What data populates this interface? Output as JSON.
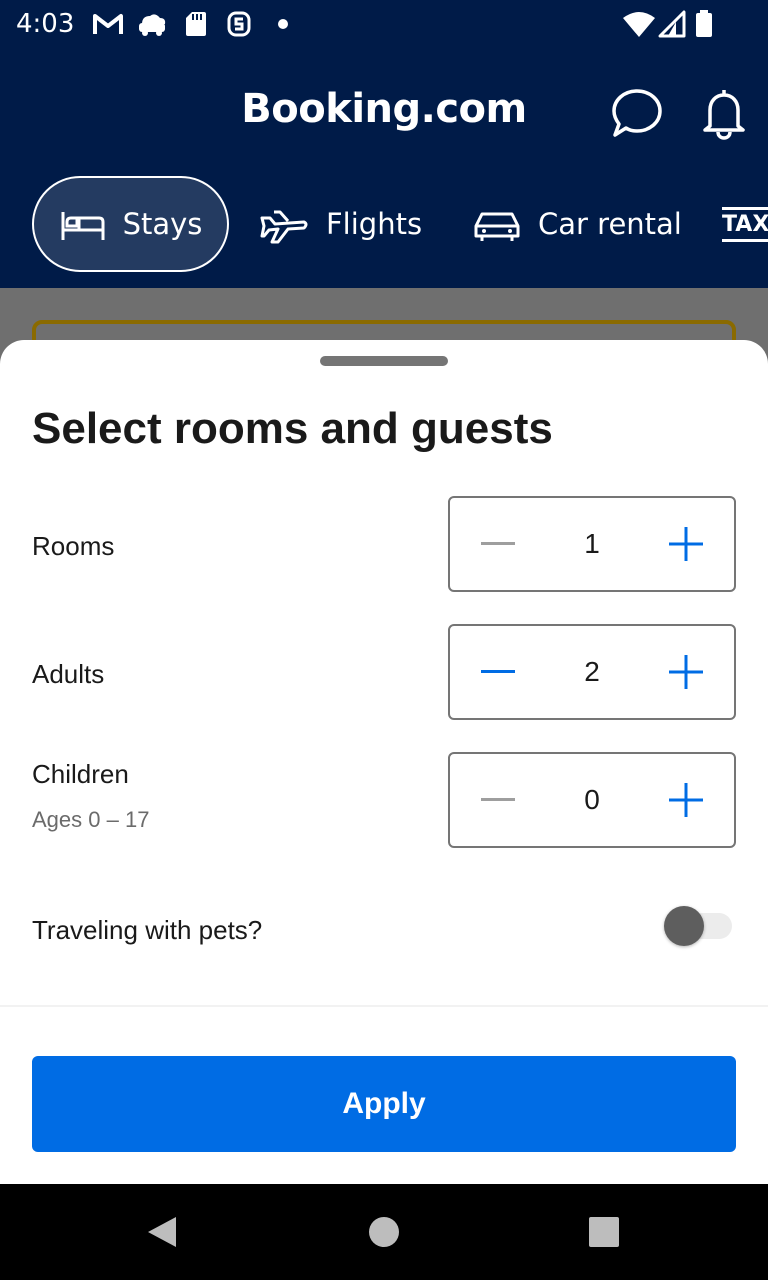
{
  "status_bar": {
    "time": "4:03",
    "left_icons": [
      "gmail-icon",
      "cloud-car-icon",
      "sd-card-icon",
      "s-icon",
      "dot-icon"
    ],
    "right_icons": [
      "wifi-icon",
      "signal-icon",
      "battery-icon"
    ]
  },
  "header": {
    "logo": "Booking.com",
    "actions": [
      "chat-icon",
      "bell-icon"
    ],
    "tabs": [
      {
        "label": "Stays",
        "icon": "bed-icon",
        "selected": true
      },
      {
        "label": "Flights",
        "icon": "plane-icon",
        "selected": false
      },
      {
        "label": "Car rental",
        "icon": "car-icon",
        "selected": false
      },
      {
        "label": "TAXI",
        "icon": "taxi-icon",
        "selected": false
      }
    ]
  },
  "sheet": {
    "title": "Select rooms and guests",
    "rooms": {
      "label": "Rooms",
      "value": "1",
      "minus_enabled": false
    },
    "adults": {
      "label": "Adults",
      "value": "2",
      "minus_enabled": true
    },
    "children": {
      "label": "Children",
      "sublabel": "Ages 0 – 17",
      "value": "0",
      "minus_enabled": false
    },
    "pets": {
      "label": "Traveling with pets?",
      "on": false
    },
    "apply_label": "Apply"
  },
  "colors": {
    "brand_navy": "#001b48",
    "accent_blue": "#006ce4",
    "disabled": "#9e9e9e"
  },
  "nav_bar": [
    "back-icon",
    "home-icon",
    "recents-icon"
  ]
}
